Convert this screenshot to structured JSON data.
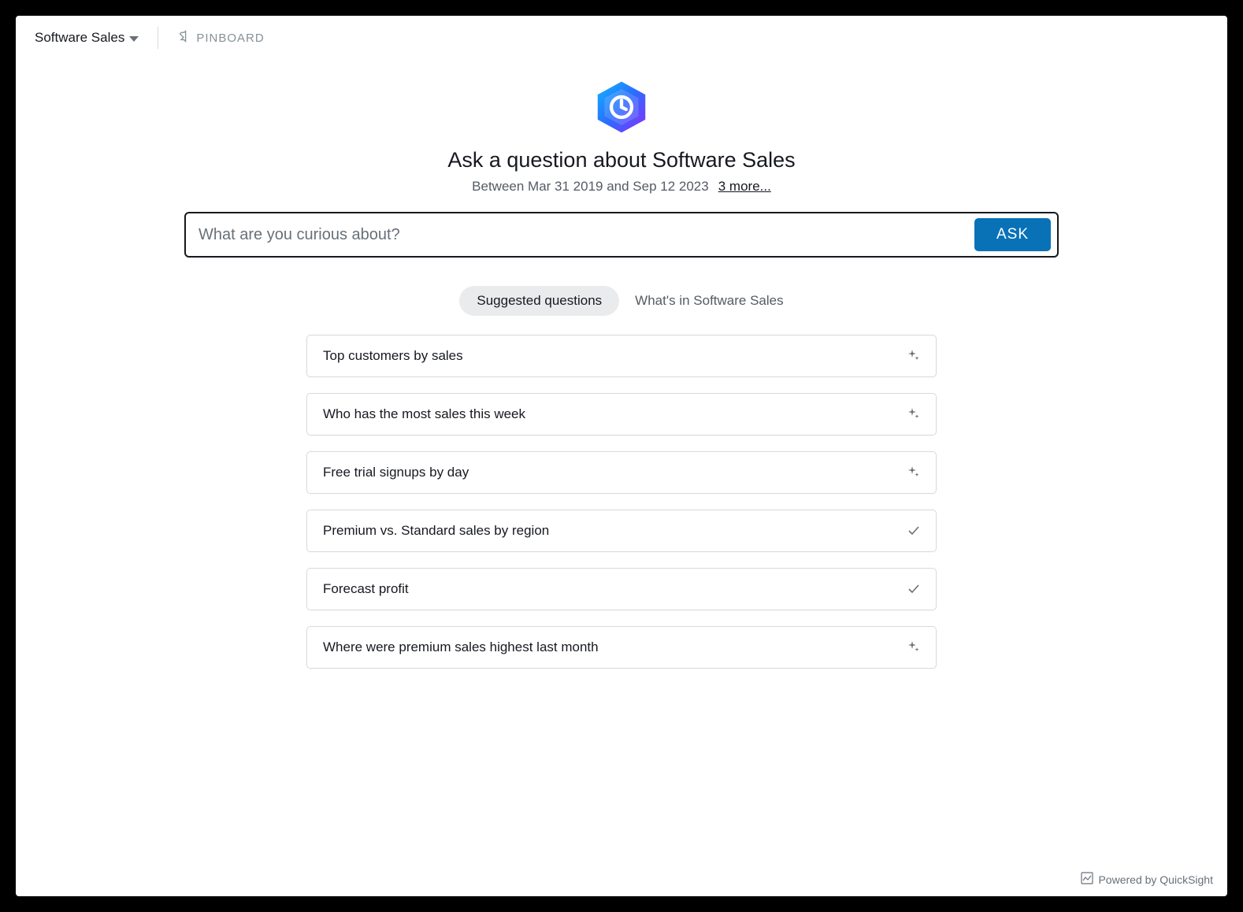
{
  "header": {
    "topic_name": "Software Sales",
    "pinboard_label": "PINBOARD"
  },
  "hero": {
    "title": "Ask a question about Software Sales",
    "date_range": "Between Mar 31 2019 and Sep 12 2023",
    "more_link": "3 more..."
  },
  "search": {
    "placeholder": "What are you curious about?",
    "ask_label": "ASK"
  },
  "tabs": {
    "suggested_label": "Suggested questions",
    "whats_in_label": "What's in Software Sales"
  },
  "suggestions": [
    {
      "text": "Top customers by sales",
      "icon": "sparkle"
    },
    {
      "text": "Who has the most sales this week",
      "icon": "sparkle"
    },
    {
      "text": "Free trial signups by day",
      "icon": "sparkle"
    },
    {
      "text": "Premium vs. Standard sales by region",
      "icon": "check"
    },
    {
      "text": "Forecast profit",
      "icon": "check"
    },
    {
      "text": "Where were premium sales highest last month",
      "icon": "sparkle"
    }
  ],
  "footer": {
    "powered_by": "Powered by QuickSight"
  }
}
